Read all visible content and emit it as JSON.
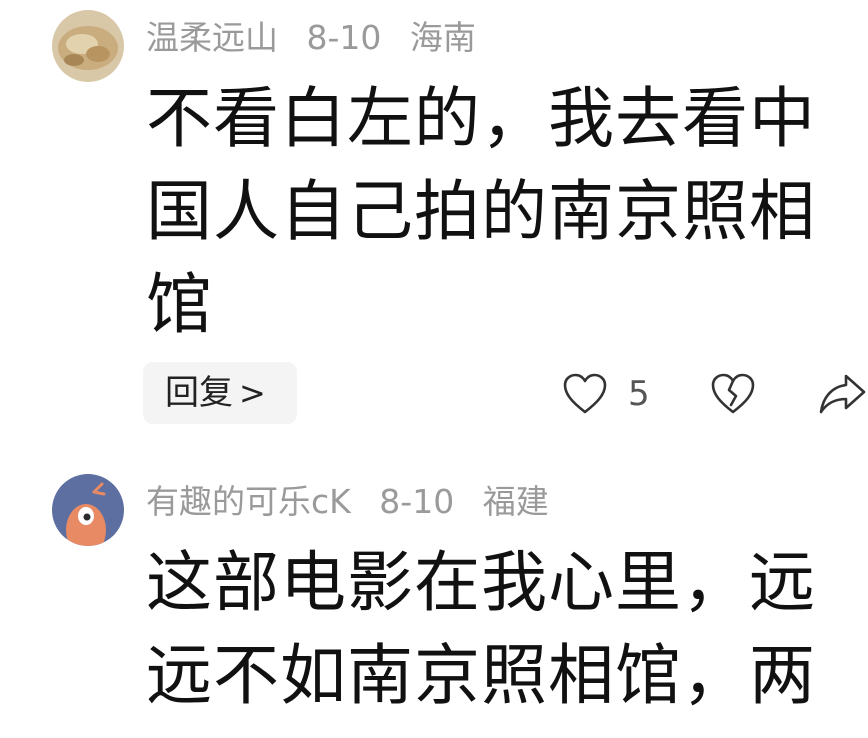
{
  "comments": [
    {
      "username": "温柔远山",
      "date": "8-10",
      "location": "海南",
      "text": "不看白左的，我去看中国人自己拍的南京照相馆",
      "reply_label": "回复",
      "reply_chevron": ">",
      "like_count": "5",
      "icons": [
        "heart-outline-icon",
        "broken-heart-icon",
        "share-icon"
      ]
    },
    {
      "username": "有趣的可乐cK",
      "date": "8-10",
      "location": "福建",
      "text": "这部电影在我心里，远远不如南京照相馆，两"
    }
  ]
}
